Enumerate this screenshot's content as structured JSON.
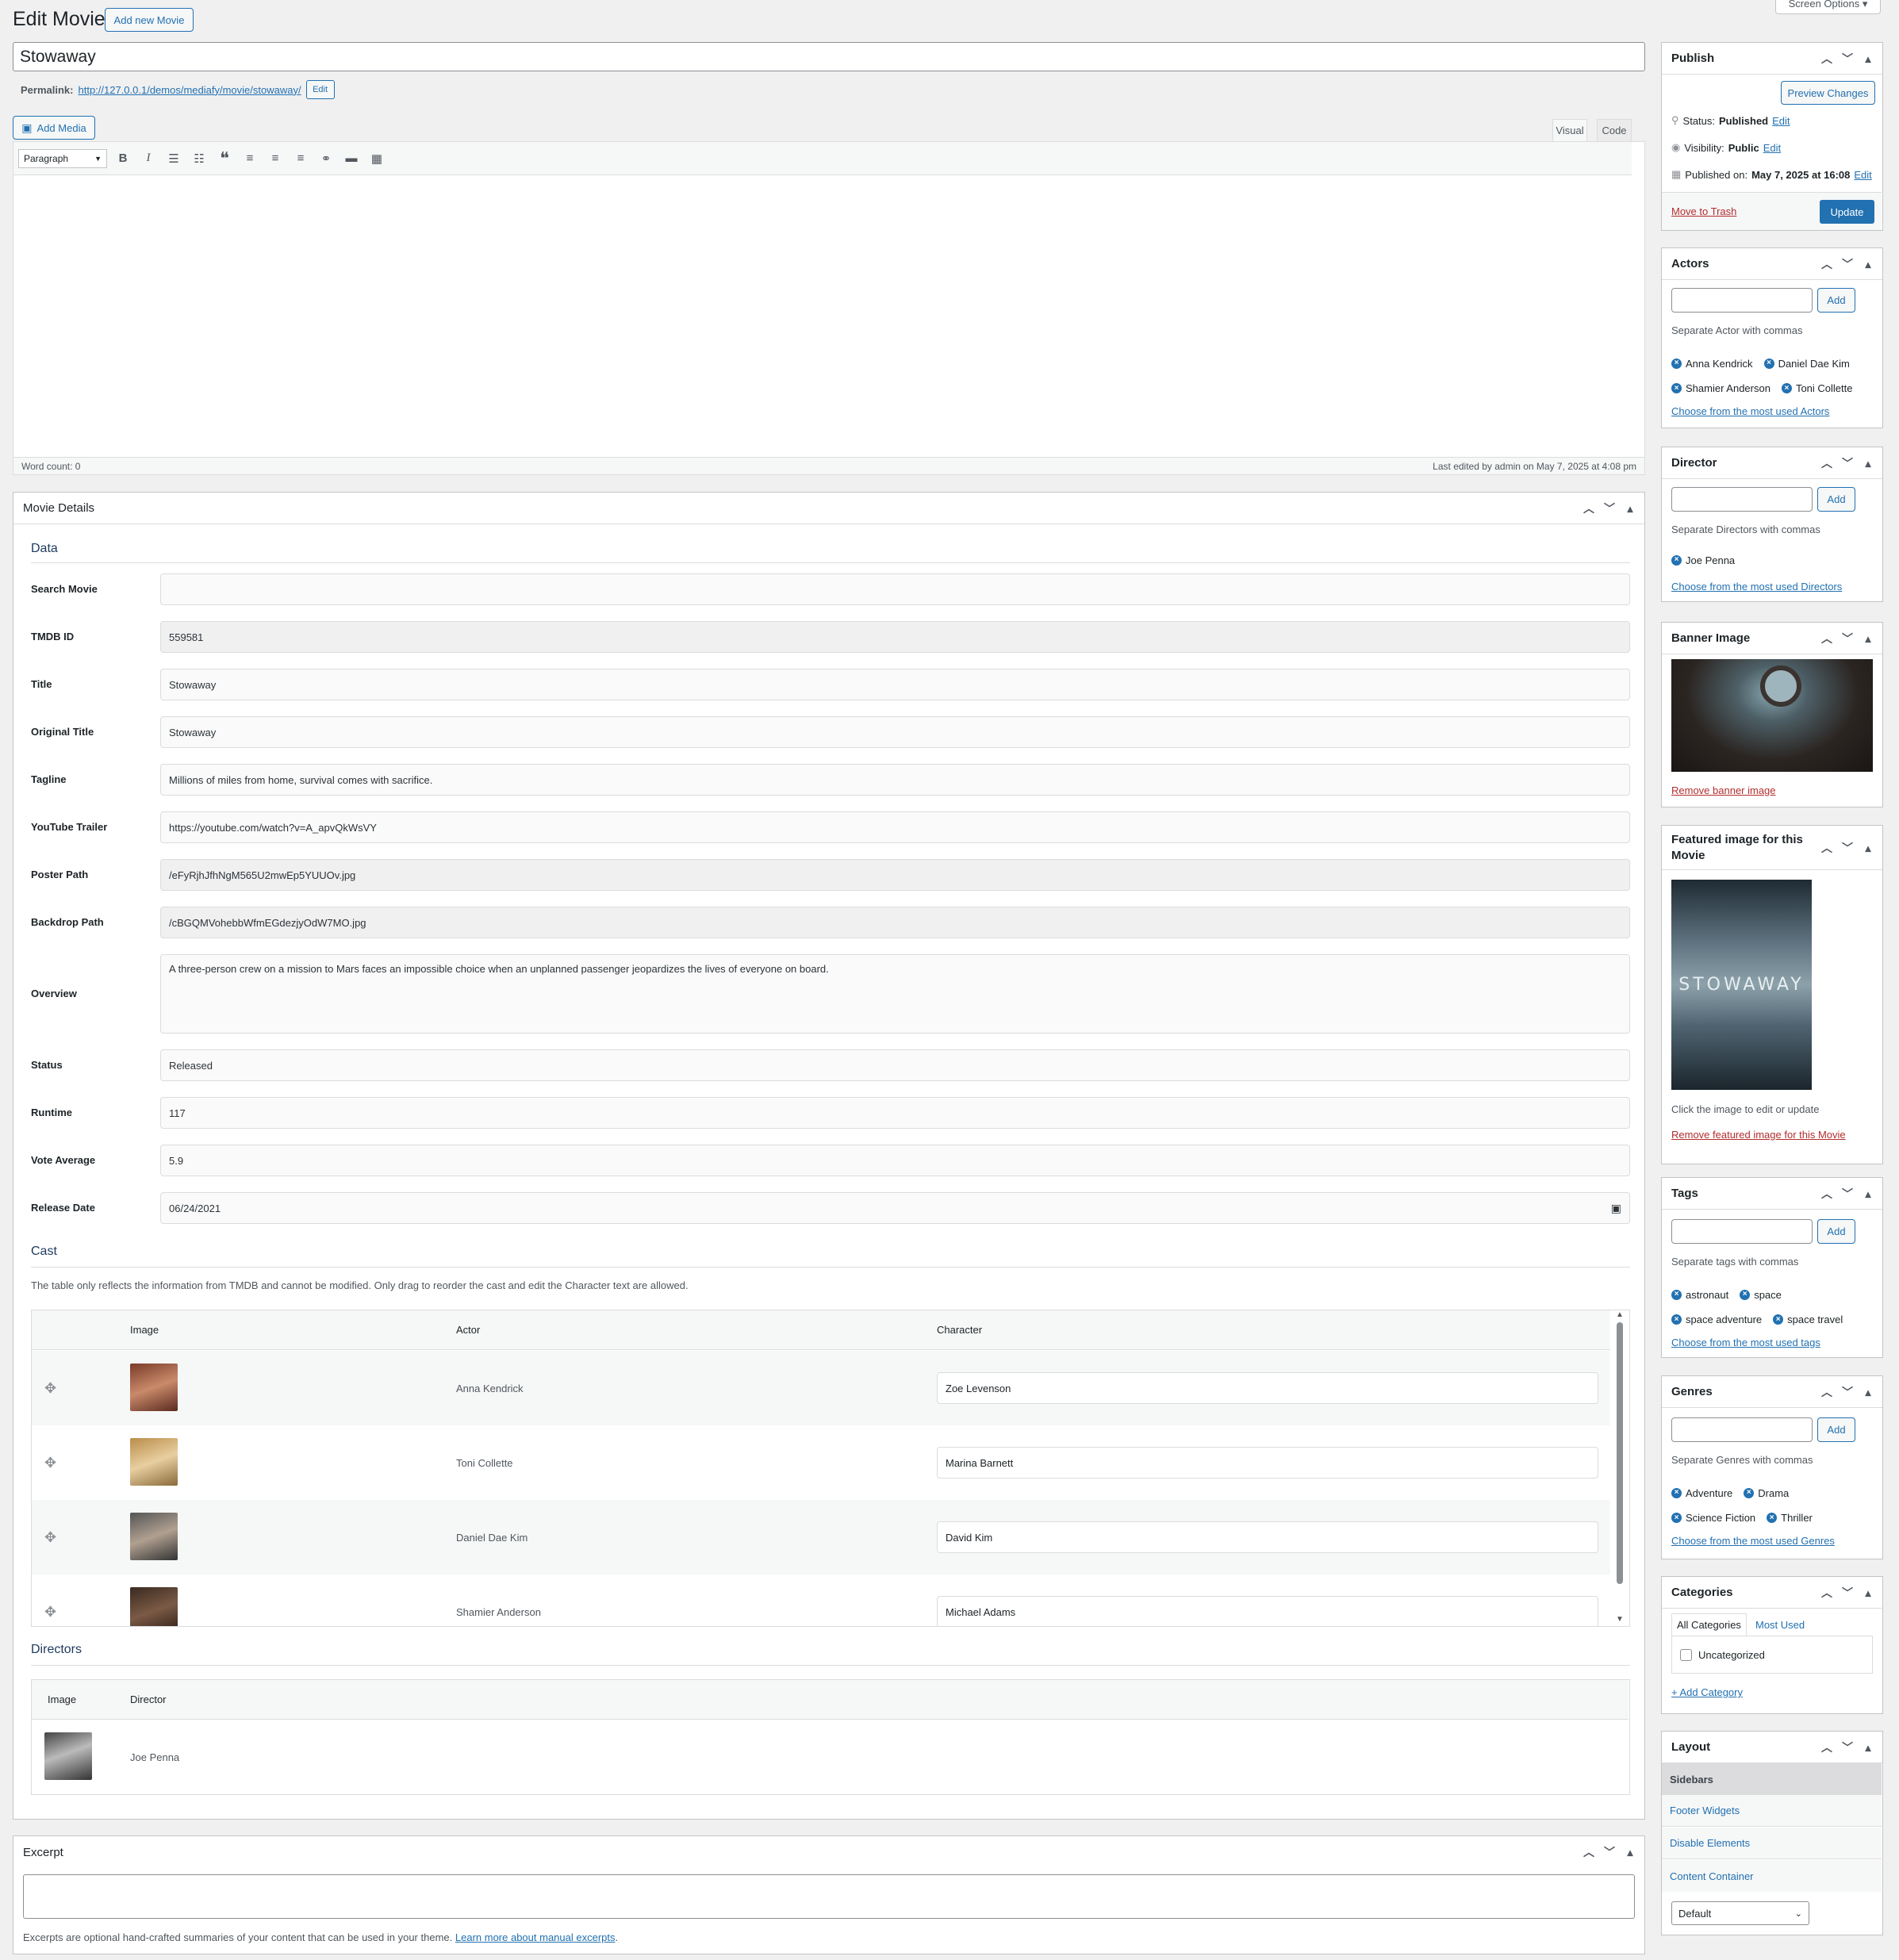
{
  "header": {
    "title": "Edit Movie",
    "add_new": "Add new Movie",
    "screen_options": "Screen Options ▾"
  },
  "post": {
    "title": "Stowaway",
    "permalink_label": "Permalink:",
    "permalink_url": "http://127.0.0.1/demos/mediafy/movie/stowaway/",
    "permalink_edit": "Edit"
  },
  "editor": {
    "add_media": "Add Media",
    "tab_visual": "Visual",
    "tab_code": "Code",
    "format_select": "Paragraph",
    "word_count": "Word count: 0",
    "last_edited": "Last edited by admin on May 7, 2025 at 4:08 pm"
  },
  "movie_details": {
    "title": "Movie Details",
    "section_data": "Data",
    "fields": [
      {
        "label": "Search Movie",
        "value": ""
      },
      {
        "label": "TMDB ID",
        "value": "559581"
      },
      {
        "label": "Title",
        "value": "Stowaway"
      },
      {
        "label": "Original Title",
        "value": "Stowaway"
      },
      {
        "label": "Tagline",
        "value": "Millions of miles from home, survival comes with sacrifice."
      },
      {
        "label": "YouTube Trailer",
        "value": "https://youtube.com/watch?v=A_apvQkWsVY"
      },
      {
        "label": "Poster Path",
        "value": "/eFyRjhJfhNgM565U2mwEp5YUUOv.jpg"
      },
      {
        "label": "Backdrop Path",
        "value": "/cBGQMVohebbWfmEGdezjyOdW7MO.jpg"
      },
      {
        "label": "Overview",
        "value": "A three-person crew on a mission to Mars faces an impossible choice when an unplanned passenger jeopardizes the lives of everyone on board."
      },
      {
        "label": "Status",
        "value": "Released"
      },
      {
        "label": "Runtime",
        "value": "117"
      },
      {
        "label": "Vote Average",
        "value": "5.9"
      },
      {
        "label": "Release Date",
        "value": "06/24/2021"
      }
    ],
    "section_cast": "Cast",
    "cast_note": "The table only reflects the information from TMDB and cannot be modified. Only drag to reorder the cast and edit the Character text are allowed.",
    "cast_headers": [
      "Image",
      "Actor",
      "Character"
    ],
    "cast": [
      {
        "actor": "Anna Kendrick",
        "character": "Zoe Levenson"
      },
      {
        "actor": "Toni Collette",
        "character": "Marina Barnett"
      },
      {
        "actor": "Daniel Dae Kim",
        "character": "David Kim"
      },
      {
        "actor": "Shamier Anderson",
        "character": "Michael Adams"
      }
    ],
    "section_directors": "Directors",
    "director_headers": [
      "Image",
      "Director"
    ],
    "directors": [
      {
        "name": "Joe Penna"
      }
    ]
  },
  "excerpt": {
    "title": "Excerpt",
    "note": "Excerpts are optional hand-crafted summaries of your content that can be used in your theme.",
    "learn_more": "Learn more about manual excerpts"
  },
  "publish": {
    "title": "Publish",
    "preview": "Preview Changes",
    "status_label": "Status:",
    "status_value": "Published",
    "visibility_label": "Visibility:",
    "visibility_value": "Public",
    "published_label": "Published on:",
    "published_value": "May 7, 2025 at 16:08",
    "edit": "Edit",
    "trash": "Move to Trash",
    "update": "Update"
  },
  "actors_box": {
    "title": "Actors",
    "add": "Add",
    "hint": "Separate Actor with commas",
    "tags": [
      "Anna Kendrick",
      "Daniel Dae Kim",
      "Shamier Anderson",
      "Toni Collette"
    ],
    "most_used": "Choose from the most used Actors"
  },
  "director_box": {
    "title": "Director",
    "add": "Add",
    "hint": "Separate Directors with commas",
    "tags": [
      "Joe Penna"
    ],
    "most_used": "Choose from the most used Directors"
  },
  "banner_box": {
    "title": "Banner Image",
    "remove": "Remove banner image"
  },
  "featured_box": {
    "title": "Featured image for this Movie",
    "poster_text": "STOWAWAY",
    "hint": "Click the image to edit or update",
    "remove": "Remove featured image for this Movie"
  },
  "tags_box": {
    "title": "Tags",
    "add": "Add",
    "hint": "Separate tags with commas",
    "tags": [
      "astronaut",
      "space",
      "space adventure",
      "space travel"
    ],
    "most_used": "Choose from the most used tags"
  },
  "genres_box": {
    "title": "Genres",
    "add": "Add",
    "hint": "Separate Genres with commas",
    "tags": [
      "Adventure",
      "Drama",
      "Science Fiction",
      "Thriller"
    ],
    "most_used": "Choose from the most used Genres"
  },
  "categories_box": {
    "title": "Categories",
    "tab_all": "All Categories",
    "tab_most": "Most Used",
    "items": [
      "Uncategorized"
    ],
    "add": "+ Add Category"
  },
  "layout_box": {
    "title": "Layout",
    "items": [
      "Sidebars",
      "Footer Widgets",
      "Disable Elements",
      "Content Container"
    ],
    "select": "Default"
  }
}
